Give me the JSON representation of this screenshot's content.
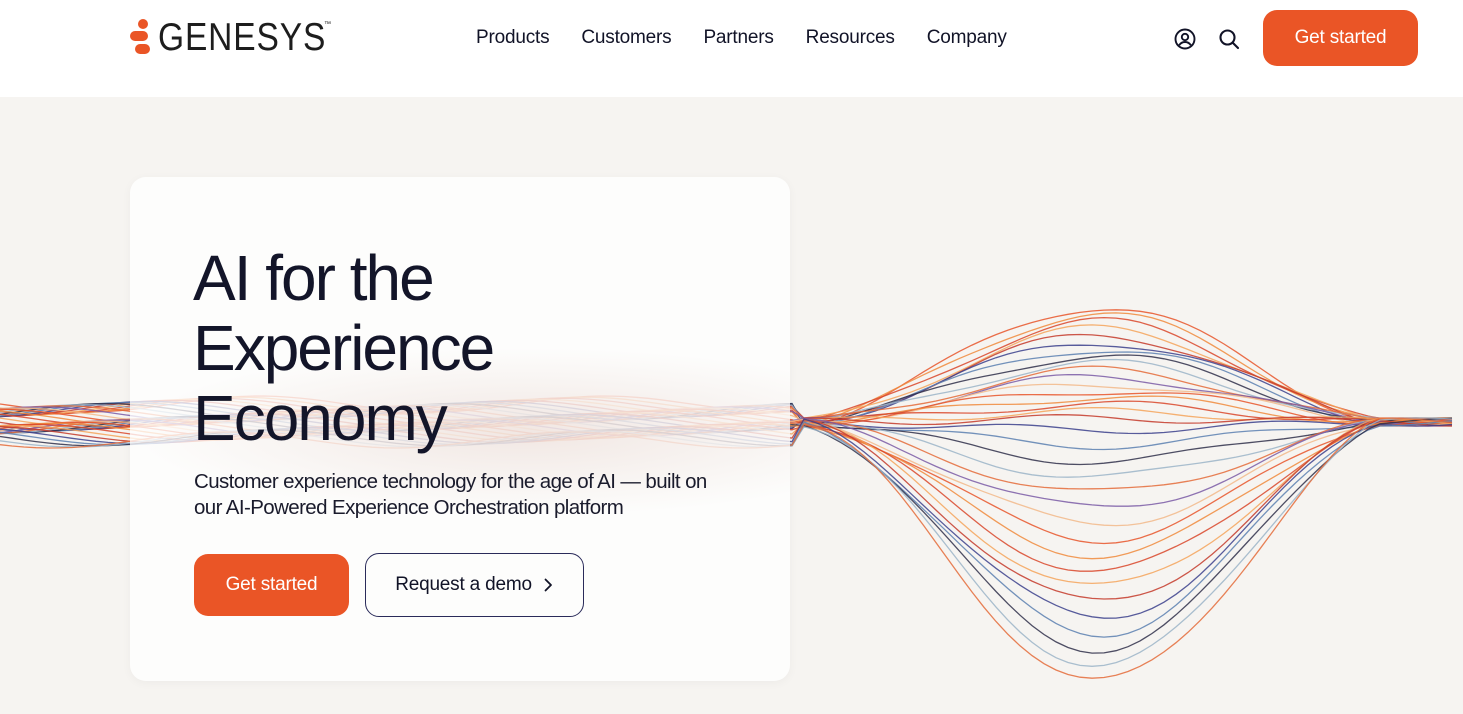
{
  "brand": {
    "name": "GENESYS",
    "trademark": "™",
    "accent": "#ea5526"
  },
  "nav": {
    "links": [
      "Products",
      "Customers",
      "Partners",
      "Resources",
      "Company"
    ],
    "icons": [
      "user-icon",
      "search-icon"
    ],
    "cta_label": "Get started"
  },
  "hero": {
    "headline_lines": [
      "AI for the",
      "Experience",
      "Economy"
    ],
    "subtext": "Customer experience technology for the age of AI — built on our AI-Powered Experience Orchestration platform",
    "primary_cta": "Get started",
    "secondary_cta": "Request a demo",
    "secondary_cta_icon": "chevron-right-icon"
  }
}
